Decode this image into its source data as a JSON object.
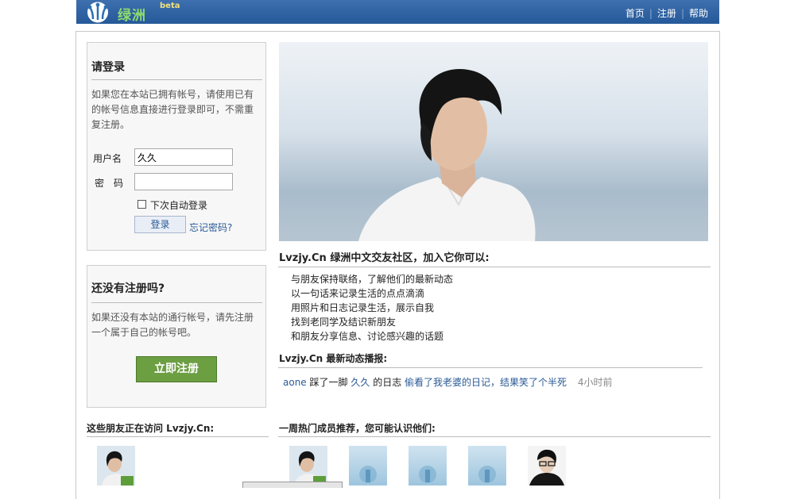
{
  "header": {
    "logo_text": "绿洲",
    "beta": "beta",
    "nav": [
      "首页",
      "注册",
      "帮助"
    ]
  },
  "login": {
    "title": "请登录",
    "desc": "如果您在本站已拥有帐号，请使用已有的帐号信息直接进行登录即可，不需重复注册。",
    "username_label": "用户名",
    "username_value": "久久",
    "password_label": "密　码",
    "remember_label": "下次自动登录",
    "submit": "登录",
    "forgot": "忘记密码?"
  },
  "register": {
    "title": "还没有注册吗?",
    "desc": "如果还没有本站的通行帐号，请先注册一个属于自己的帐号吧。",
    "button": "立即注册"
  },
  "intro": {
    "title": "Lvzjy.Cn 绿洲中文交友社区，加入它你可以:",
    "features": [
      "与朋友保持联络，了解他们的最新动态",
      "以一句话来记录生活的点点滴滴",
      "用照片和日志记录生活，展示自我",
      "找到老同学及结识新朋友",
      "和朋友分享信息、讨论感兴趣的话题"
    ]
  },
  "news": {
    "title": "Lvzjy.Cn 最新动态播报:",
    "actor": "aone",
    "verb": "踩了一脚",
    "target_user": "久久",
    "object": "的日志",
    "entry": "偷看了我老婆的日记，结果笑了个半死",
    "time": "4小时前"
  },
  "visitors": {
    "title": "这些朋友正在访问 Lvzjy.Cn:"
  },
  "popular": {
    "title": "一周热门成员推荐，您可能认识他们:"
  },
  "colors": {
    "header": "#255999",
    "accent_link": "#2a5a96",
    "register_button": "#6c9e42"
  }
}
